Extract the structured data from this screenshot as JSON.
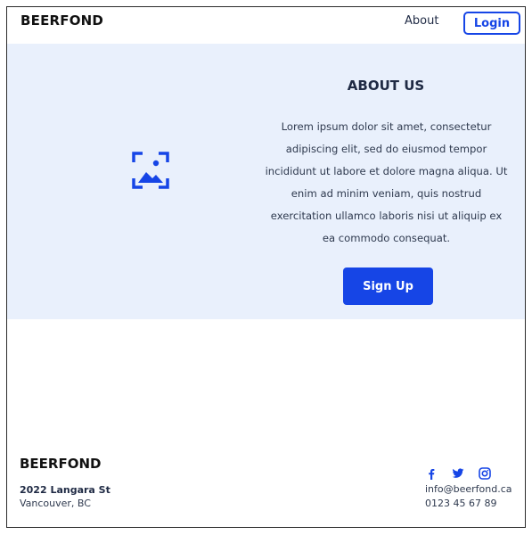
{
  "header": {
    "brand": "BEERFOND",
    "nav_about": "About",
    "login": "Login"
  },
  "hero": {
    "image_icon": "image-placeholder-icon",
    "title": "ABOUT US",
    "text": "Lorem ipsum dolor sit amet, consectetur adipiscing elit, sed do eiusmod tempor incididunt ut labore et dolore magna aliqua. Ut enim ad minim veniam, quis nostrud exercitation ullamco laboris nisi ut aliquip ex ea commodo consequat.",
    "signup": "Sign Up"
  },
  "footer": {
    "brand": "BEERFOND",
    "address_street": "2022 Langara St",
    "address_city": "Vancouver, BC",
    "social_icons": [
      "facebook-icon",
      "twitter-icon",
      "instagram-icon"
    ],
    "email": "info@beerfond.ca",
    "phone": "0123 45 67 89"
  },
  "colors": {
    "accent": "#1645e6",
    "hero_bg": "#e9f0fc",
    "text_dark": "#1f2a44"
  }
}
